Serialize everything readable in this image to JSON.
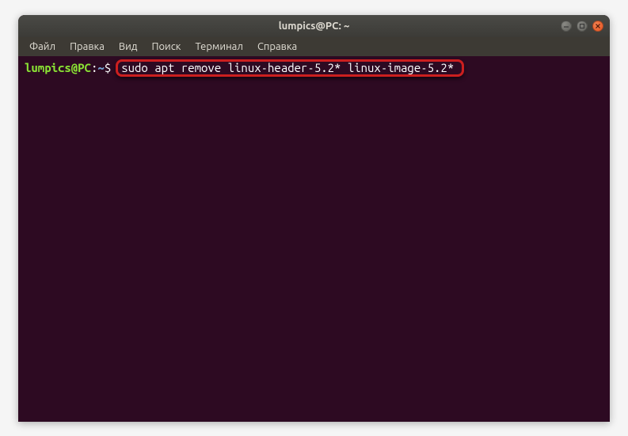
{
  "titlebar": {
    "title": "lumpics@PC: ~"
  },
  "menu": {
    "items": [
      "Файл",
      "Правка",
      "Вид",
      "Поиск",
      "Терминал",
      "Справка"
    ]
  },
  "prompt": {
    "user_host": "lumpics@PC",
    "colon": ":",
    "path": "~",
    "dollar": "$"
  },
  "command": "sudo apt remove linux-header-5.2* linux-image-5.2*"
}
